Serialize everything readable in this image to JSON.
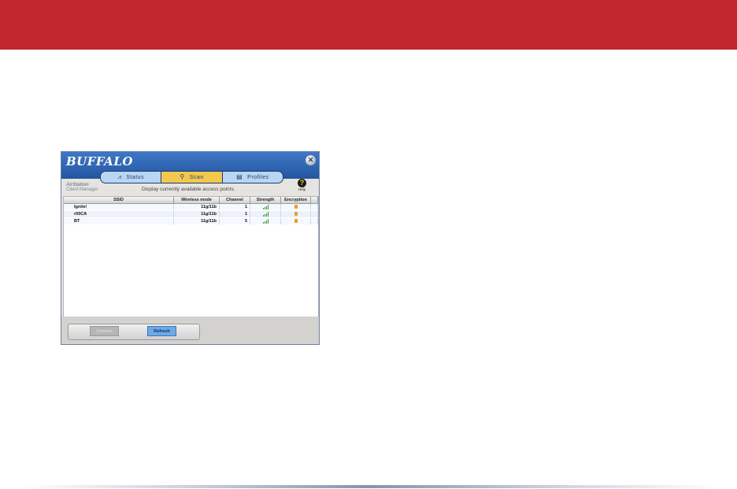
{
  "app": {
    "logo": "BUFFALO",
    "close_icon": "✕",
    "brand_line1": "AirStation",
    "brand_line2": "Client Manager",
    "subtitle": "Display currently available access points.",
    "help_label": "Help",
    "help_icon": "?"
  },
  "tabs": [
    {
      "label": "Status",
      "icon": "pulse-icon",
      "glyph": "⩘",
      "active": false
    },
    {
      "label": "Scan",
      "icon": "magnifier-icon",
      "glyph": "⚲",
      "active": true
    },
    {
      "label": "Profiles",
      "icon": "document-icon",
      "glyph": "▤",
      "active": false
    }
  ],
  "table": {
    "headers": [
      "SSID",
      "Wireless mode",
      "Channel",
      "Strength",
      "Encryption"
    ],
    "rows": [
      {
        "ssid": "Ignite!",
        "mode": "11g/11b",
        "channel": "1",
        "strength": 4,
        "encrypted": true
      },
      {
        "ssid": "r00CA",
        "mode": "11g/11b",
        "channel": "1",
        "strength": 4,
        "encrypted": true
      },
      {
        "ssid": "BT",
        "mode": "11g/11b",
        "channel": "5",
        "strength": 4,
        "encrypted": true
      }
    ]
  },
  "buttons": {
    "connect": "Connect",
    "refresh": "Refresh"
  },
  "colors": {
    "top_band": "#c1272d",
    "titlebar": "#2a5fa8",
    "active_tab": "#f2c94c"
  }
}
